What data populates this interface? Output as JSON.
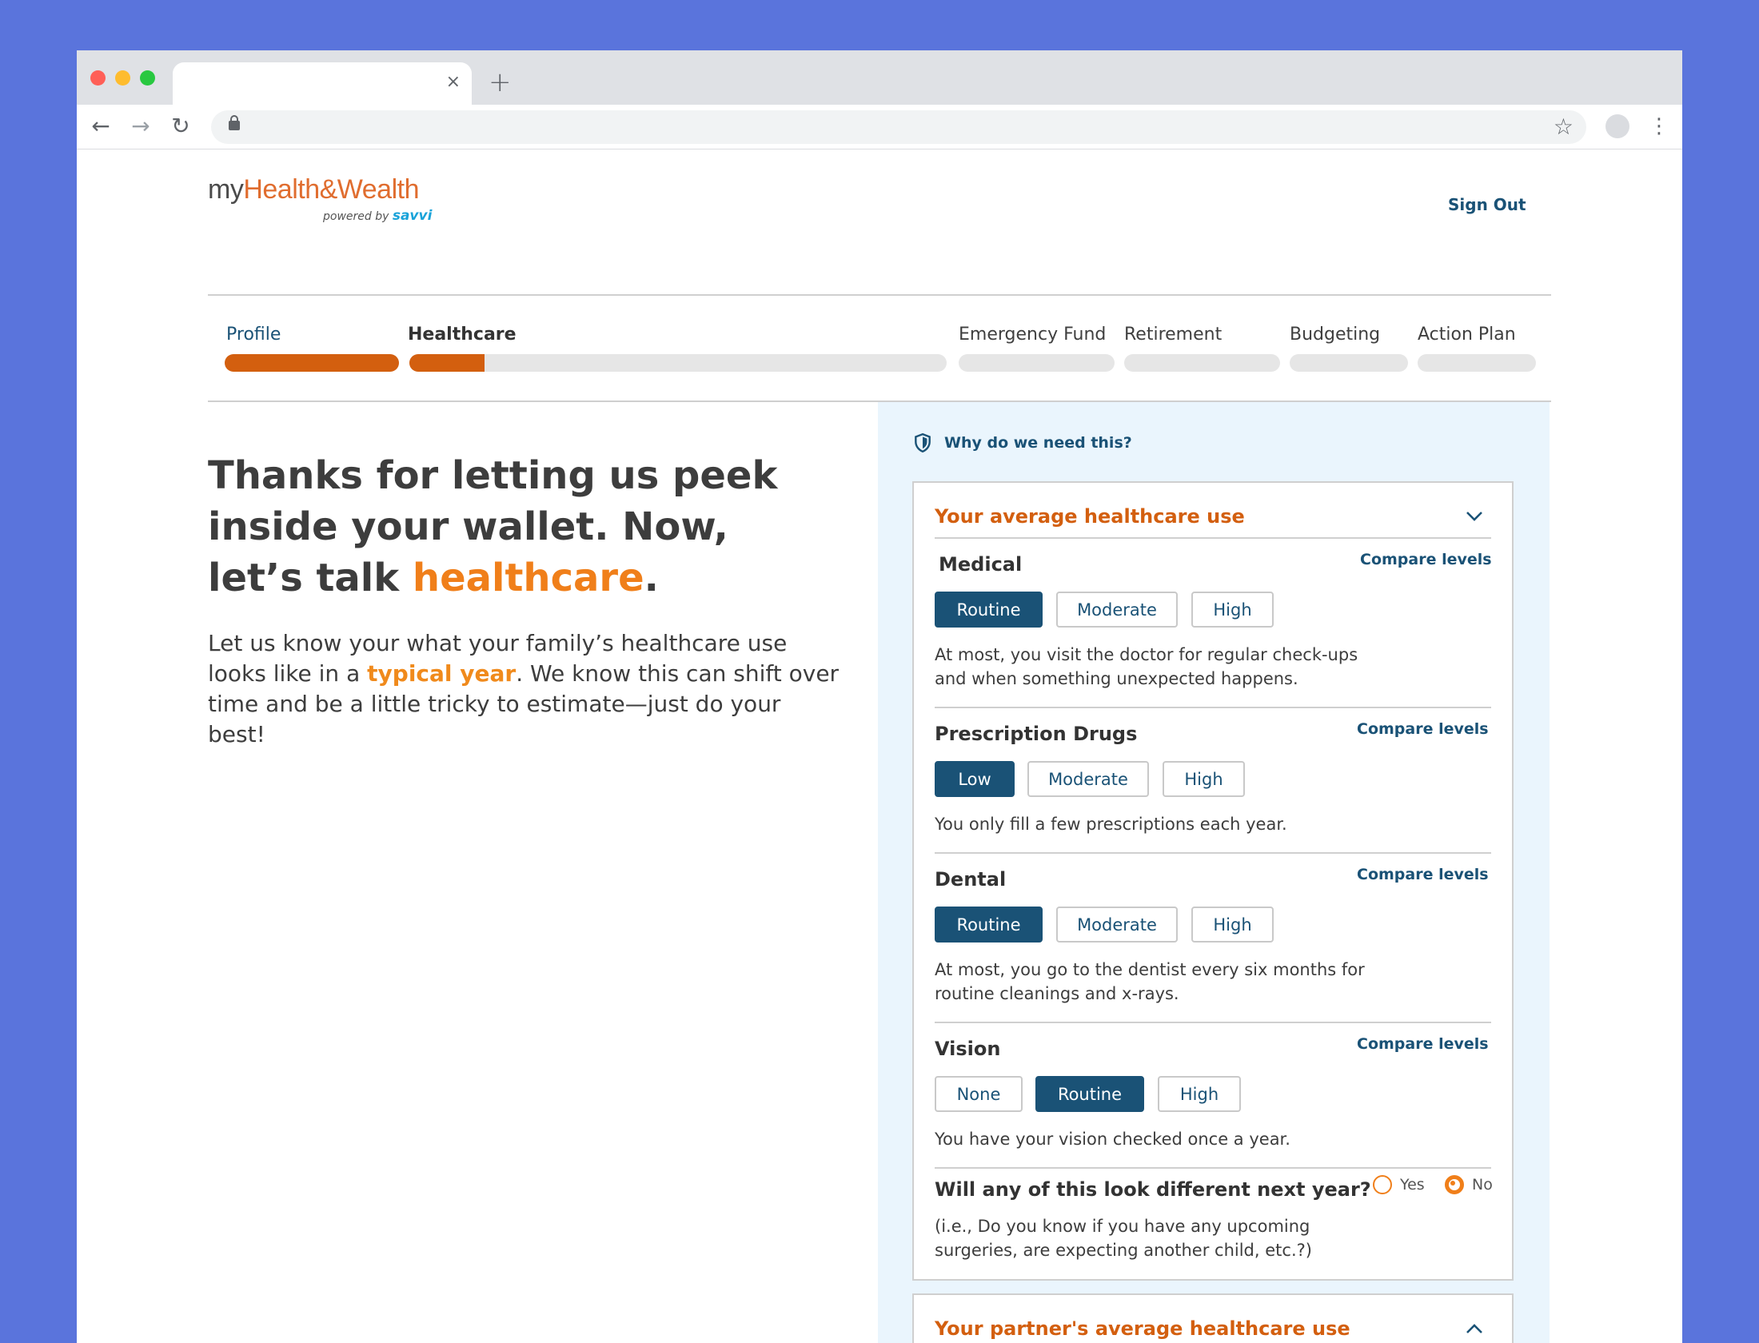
{
  "browser": {
    "tab_close": "×",
    "new_tab": "+",
    "back": "←",
    "forward": "→",
    "reload": "↻",
    "star": "☆",
    "menu": "⋮"
  },
  "header": {
    "logo_my": "my",
    "logo_rest": "Health&Wealth",
    "logo_powered": "powered by ",
    "logo_savvi": "savvi",
    "sign_out": "Sign Out"
  },
  "progress": {
    "steps": [
      {
        "label": "Profile",
        "fill": 1.0
      },
      {
        "label": "Healthcare",
        "fill": 0.14
      },
      {
        "label": "Emergency Fund",
        "fill": 0
      },
      {
        "label": "Retirement",
        "fill": 0
      },
      {
        "label": "Budgeting",
        "fill": 0
      },
      {
        "label": "Action Plan",
        "fill": 0
      }
    ]
  },
  "main": {
    "headline_part1": "Thanks for letting us peek inside your wallet. Now, let’s talk ",
    "headline_accent": "healthcare",
    "headline_end": ".",
    "intro_part1": "Let us know your what your family’s healthcare use looks like in a ",
    "intro_accent": "typical year",
    "intro_part2": ". We know this can shift over time and be a little tricky to estimate—just do your best!"
  },
  "panel": {
    "why_link": "Why do we need this?",
    "card_title": "Your average healthcare use",
    "sections": [
      {
        "title": "Medical",
        "compare": "Compare levels",
        "options": [
          "Routine",
          "Moderate",
          "High"
        ],
        "selected": "Routine",
        "description": "At most, you visit the doctor for regular check-ups and when something unexpected happens."
      },
      {
        "title": "Prescription Drugs",
        "compare": "Compare levels",
        "options": [
          "Low",
          "Moderate",
          "High"
        ],
        "selected": "Low",
        "description": "You only fill a few prescriptions each year."
      },
      {
        "title": "Dental",
        "compare": "Compare levels",
        "options": [
          "Routine",
          "Moderate",
          "High"
        ],
        "selected": "Routine",
        "description": "At most, you go to the dentist every six months for routine cleanings and x-rays."
      },
      {
        "title": "Vision",
        "compare": "Compare levels",
        "options": [
          "None",
          "Routine",
          "High"
        ],
        "selected": "Routine",
        "description": "You have your vision checked once a year."
      }
    ],
    "question": {
      "title": "Will any of this look different next year?",
      "description": "(i.e., Do you know if you have any upcoming surgeries, are expecting another child, etc.?)",
      "options": [
        "Yes",
        "No"
      ],
      "selected": "No"
    },
    "partner_card_title": "Your partner's average healthcare use"
  }
}
